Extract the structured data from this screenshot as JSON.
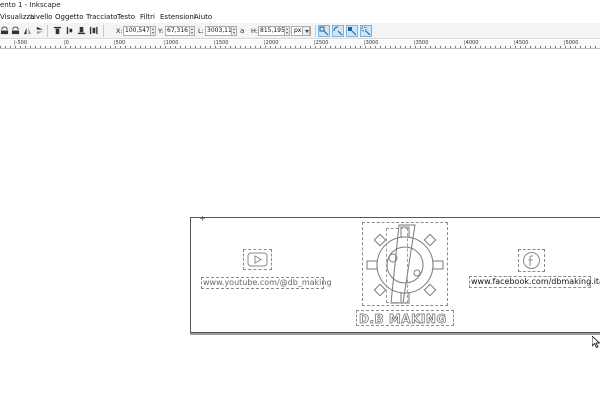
{
  "window": {
    "title": "ento 1 - Inkscape"
  },
  "menu": {
    "items": [
      {
        "label": "Visualizza",
        "accel": "V"
      },
      {
        "label": "Livello",
        "accel": "L"
      },
      {
        "label": "Oggetto",
        "accel": "O"
      },
      {
        "label": "Tracciato",
        "accel": "T"
      },
      {
        "label": "Testo",
        "accel": "T"
      },
      {
        "label": "Filtri",
        "accel": "r"
      },
      {
        "label": "Estensioni",
        "accel": "n"
      },
      {
        "label": "Aiuto",
        "accel": "A"
      }
    ]
  },
  "toolbar": {
    "x_label": "X:",
    "x_value": "100,547",
    "y_label": "Y:",
    "y_value": "67,316",
    "w_label": "L:",
    "w_value": "3003,11",
    "h_label": "H:",
    "h_value": "815,195",
    "unit": "px",
    "lock_icon": "lock-icon"
  },
  "ruler": {
    "labels": [
      "|-500",
      "|0",
      "|500",
      "|1000",
      "|1500",
      "|2000",
      "|2500",
      "|3000",
      "|3500",
      "|4000",
      "|4500",
      "|5000"
    ]
  },
  "artwork": {
    "youtube_text": "www.youtube.com/@db_making",
    "facebook_text": "www.facebook.com/dbmaking.ita",
    "logo_text": "D.B MAKING"
  },
  "colors": {
    "toggle_active": "#cde6f7",
    "page_border": "#555555",
    "guide_dash": "#8a8a8a"
  }
}
